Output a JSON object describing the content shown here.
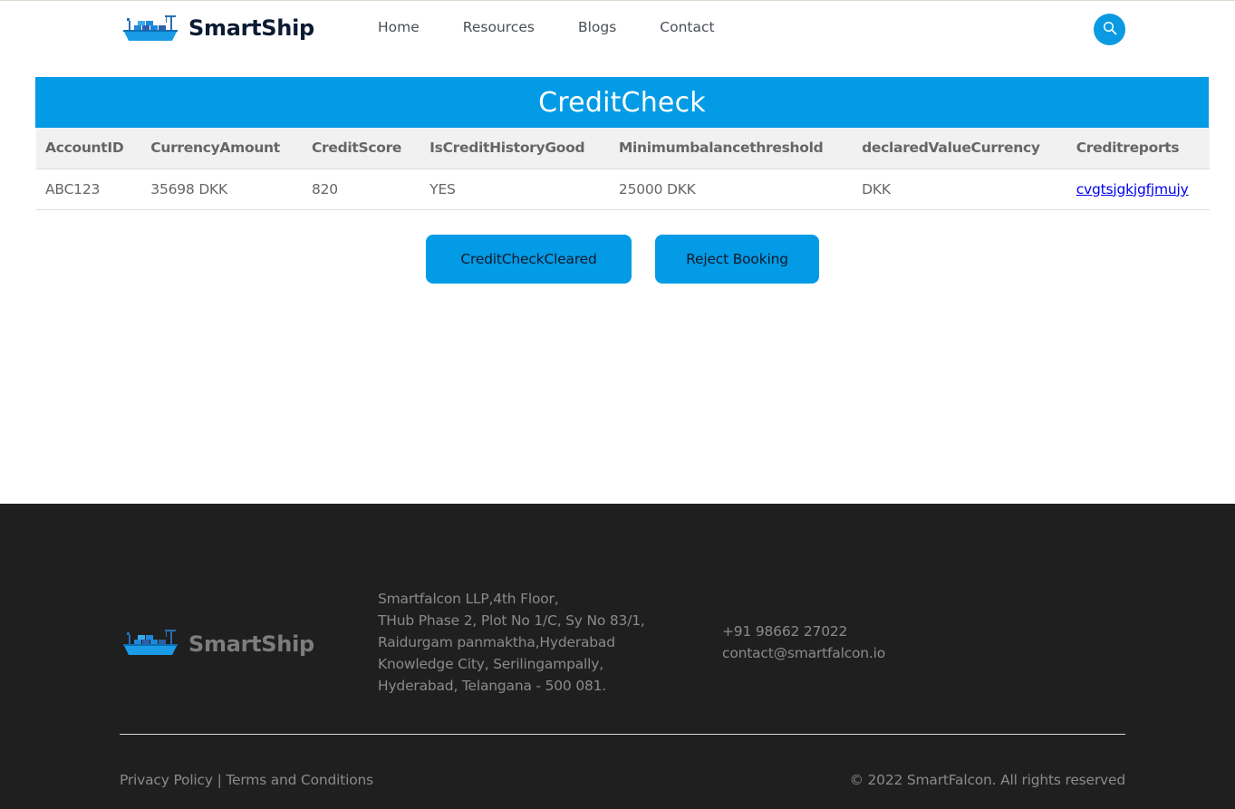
{
  "header": {
    "brand": "SmartShip",
    "nav": [
      "Home",
      "Resources",
      "Blogs",
      "Contact"
    ]
  },
  "banner": {
    "title": "CreditCheck"
  },
  "table": {
    "columns": [
      "AccountID",
      "CurrencyAmount",
      "CreditScore",
      "IsCreditHistoryGood",
      "Minimumbalancethreshold",
      "declaredValueCurrency",
      "Creditreports"
    ],
    "rows": [
      [
        "ABC123",
        "35698 DKK",
        "820",
        "YES",
        "25000 DKK",
        "DKK",
        "cvgtsjgkjgfjmujy"
      ]
    ]
  },
  "actions": {
    "cleared_label": "CreditCheckCleared",
    "reject_label": "Reject Booking"
  },
  "footer": {
    "brand": "SmartShip",
    "address": [
      "Smartfalcon LLP,4th Floor,",
      "THub Phase 2, Plot No 1/C, Sy No 83/1,",
      "Raidurgam panmaktha,Hyderabad",
      "Knowledge City, Serilingampally,",
      "Hyderabad, Telangana - 500 081."
    ],
    "phone": "+91 98662 27022",
    "email": "contact@smartfalcon.io",
    "privacy": "Privacy Policy",
    "separator": "|",
    "terms": "Terms and Conditions",
    "copyright": "© 2022 SmartFalcon. All rights reserved"
  },
  "icons": {
    "logo": "ship-logo-icon",
    "search": "search-icon"
  },
  "colors": {
    "accent": "#039be5",
    "footer_bg": "#1f1f1f",
    "brand_text": "#0b1b33"
  }
}
